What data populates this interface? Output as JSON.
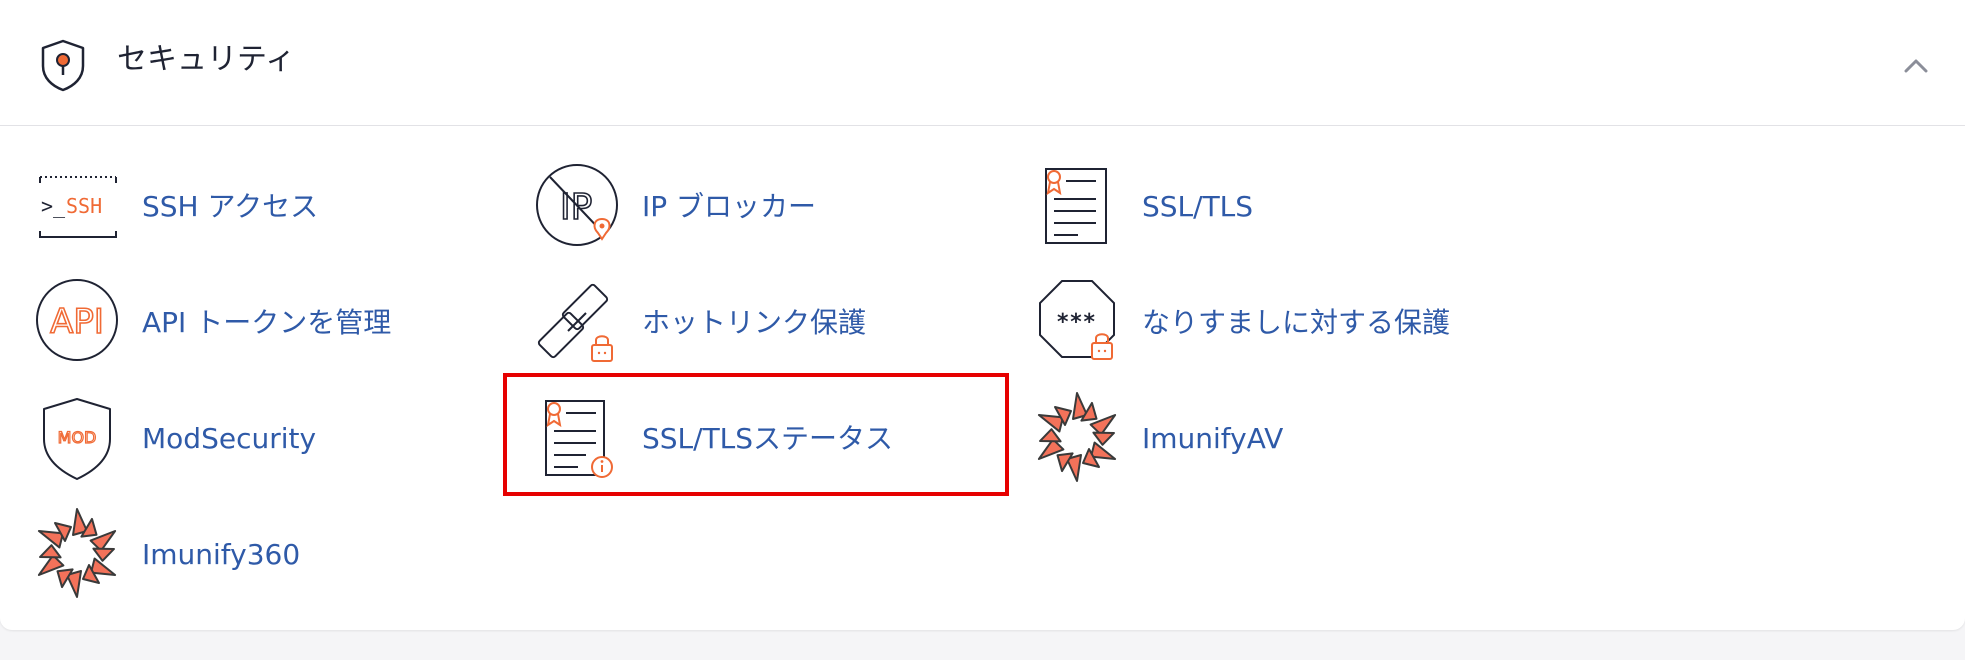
{
  "section": {
    "title": "セキュリティ",
    "colors": {
      "accent": "#f06a35",
      "link": "#2f5aa8",
      "highlight": "#e60000"
    }
  },
  "items": [
    {
      "label": "SSH アクセス",
      "icon": "ssh-terminal-icon",
      "ssh_glyph": ">_",
      "ssh_text": "SSH"
    },
    {
      "label": "IP ブロッカー",
      "icon": "ip-blocker-icon",
      "ip_text": "IP"
    },
    {
      "label": "SSL/TLS",
      "icon": "ssl-certificate-icon"
    },
    {
      "label": "API トークンを管理",
      "icon": "api-token-icon",
      "api_text": "API"
    },
    {
      "label": "ホットリンク保護",
      "icon": "hotlink-chain-icon"
    },
    {
      "label": "なりすましに対する保護",
      "icon": "leech-protection-icon",
      "stars": "***"
    },
    {
      "label": "ModSecurity",
      "icon": "modsecurity-shield-icon",
      "mod_text": "MOD"
    },
    {
      "label": "SSL/TLSステータス",
      "icon": "ssl-status-icon"
    },
    {
      "label": "ImunifyAV",
      "icon": "imunifyav-logo-icon"
    },
    {
      "label": "Imunify360",
      "icon": "imunify360-logo-icon"
    }
  ]
}
